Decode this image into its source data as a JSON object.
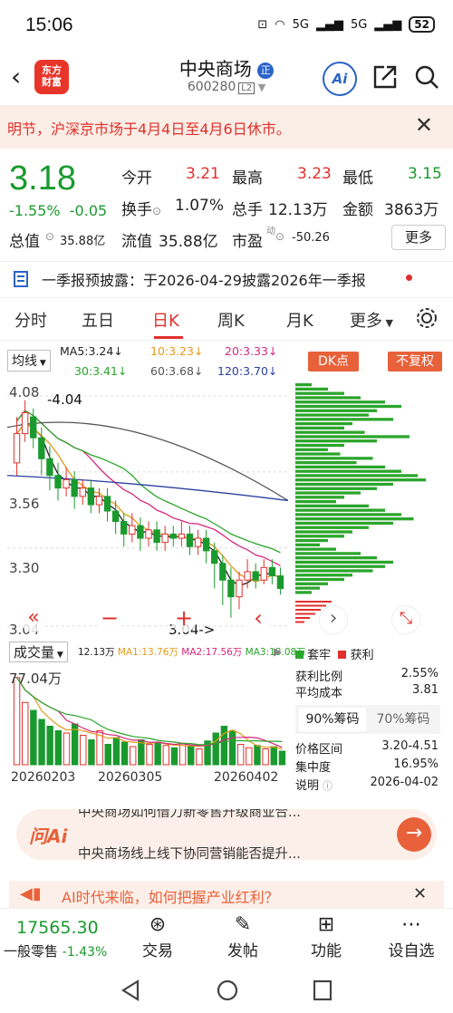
{
  "status_bar": {
    "time": "15:06",
    "battery": "52",
    "signal1": "5G",
    "signal2": "5G"
  },
  "header": {
    "logo_line1": "东方",
    "logo_line2": "财富",
    "stock_name": "中央商场",
    "name_badge": "正",
    "stock_code": "600280",
    "level_badge": "L2",
    "ai_label": "Ai"
  },
  "notice": {
    "text": "明节，沪深京市场于4月4日至4月6日休市。"
  },
  "quote": {
    "price": "3.18",
    "change_pct": "-1.55%",
    "change_amt": "-0.05",
    "open_label": "今开",
    "open": "3.21",
    "high_label": "最高",
    "high": "3.23",
    "low_label": "最低",
    "low": "3.15",
    "turnover_label": "换手",
    "turnover": "1.07%",
    "volume_label": "总手",
    "volume": "12.13万",
    "amount_label": "金额",
    "amount": "3863万",
    "mktcap_label": "总值",
    "mktcap": "35.88亿",
    "float_label": "流值",
    "float_cap": "35.88亿",
    "pe_label": "市盈",
    "pe_sup": "动",
    "pe": "-50.26",
    "more": "更多"
  },
  "report": {
    "text": "一季报预披露：于2026-04-29披露2026年一季报"
  },
  "tabs": [
    "分时",
    "五日",
    "日K",
    "周K",
    "月K",
    "更多"
  ],
  "active_tab": "日K",
  "ma": {
    "selector": "均线",
    "ma5": "MA5:3.24↓",
    "ma10": "10:3.23↓",
    "ma20": "20:3.33↓",
    "ma30": "30:3.41↓",
    "ma60": "60:3.68↓",
    "ma120": "120:3.70↓",
    "colors": {
      "ma5": "#222222",
      "ma10": "#e39a1c",
      "ma20": "#d4287e",
      "ma30": "#2ba52b",
      "ma60": "#555555",
      "ma120": "#2a3fa0"
    }
  },
  "dk": {
    "dk_label": "DK点",
    "fq_label": "不复权"
  },
  "chart_data": {
    "type": "candlestick",
    "y_labels": [
      "4.08",
      "3.56",
      "3.30",
      "3.04"
    ],
    "high_annotation": "4.04",
    "low_annotation": "3.04->",
    "ylim": [
      3.0,
      4.1
    ],
    "candles": [
      {
        "o": 3.78,
        "c": 3.92,
        "h": 4.0,
        "l": 3.72
      },
      {
        "o": 3.92,
        "c": 4.02,
        "h": 4.08,
        "l": 3.88
      },
      {
        "o": 4.0,
        "c": 3.9,
        "h": 4.04,
        "l": 3.85
      },
      {
        "o": 3.9,
        "c": 3.8,
        "h": 3.95,
        "l": 3.72
      },
      {
        "o": 3.8,
        "c": 3.72,
        "h": 3.86,
        "l": 3.65
      },
      {
        "o": 3.72,
        "c": 3.66,
        "h": 3.78,
        "l": 3.6
      },
      {
        "o": 3.66,
        "c": 3.7,
        "h": 3.76,
        "l": 3.62
      },
      {
        "o": 3.7,
        "c": 3.62,
        "h": 3.74,
        "l": 3.56
      },
      {
        "o": 3.62,
        "c": 3.66,
        "h": 3.7,
        "l": 3.58
      },
      {
        "o": 3.66,
        "c": 3.58,
        "h": 3.7,
        "l": 3.54
      },
      {
        "o": 3.58,
        "c": 3.62,
        "h": 3.66,
        "l": 3.54
      },
      {
        "o": 3.62,
        "c": 3.55,
        "h": 3.66,
        "l": 3.5
      },
      {
        "o": 3.55,
        "c": 3.5,
        "h": 3.6,
        "l": 3.44
      },
      {
        "o": 3.5,
        "c": 3.44,
        "h": 3.54,
        "l": 3.38
      },
      {
        "o": 3.44,
        "c": 3.48,
        "h": 3.54,
        "l": 3.4
      },
      {
        "o": 3.48,
        "c": 3.42,
        "h": 3.52,
        "l": 3.36
      },
      {
        "o": 3.42,
        "c": 3.46,
        "h": 3.5,
        "l": 3.38
      },
      {
        "o": 3.46,
        "c": 3.4,
        "h": 3.5,
        "l": 3.36
      },
      {
        "o": 3.4,
        "c": 3.44,
        "h": 3.48,
        "l": 3.36
      },
      {
        "o": 3.44,
        "c": 3.42,
        "h": 3.48,
        "l": 3.38
      },
      {
        "o": 3.42,
        "c": 3.44,
        "h": 3.5,
        "l": 3.38
      },
      {
        "o": 3.44,
        "c": 3.38,
        "h": 3.48,
        "l": 3.34
      },
      {
        "o": 3.38,
        "c": 3.42,
        "h": 3.46,
        "l": 3.34
      },
      {
        "o": 3.42,
        "c": 3.36,
        "h": 3.46,
        "l": 3.3
      },
      {
        "o": 3.36,
        "c": 3.3,
        "h": 3.4,
        "l": 3.18
      },
      {
        "o": 3.3,
        "c": 3.22,
        "h": 3.34,
        "l": 3.1
      },
      {
        "o": 3.22,
        "c": 3.14,
        "h": 3.28,
        "l": 3.04
      },
      {
        "o": 3.14,
        "c": 3.22,
        "h": 3.26,
        "l": 3.08
      },
      {
        "o": 3.22,
        "c": 3.26,
        "h": 3.32,
        "l": 3.18
      },
      {
        "o": 3.26,
        "c": 3.22,
        "h": 3.3,
        "l": 3.18
      },
      {
        "o": 3.22,
        "c": 3.28,
        "h": 3.32,
        "l": 3.2
      },
      {
        "o": 3.28,
        "c": 3.24,
        "h": 3.32,
        "l": 3.2
      },
      {
        "o": 3.24,
        "c": 3.18,
        "h": 3.28,
        "l": 3.15
      }
    ],
    "volume_label": "成交量",
    "volume_value": "12.13万",
    "vol_ma1": "MA1:13.76万",
    "vol_ma2": "MA2:17.56万",
    "vol_ma3": "MA3:18.08万",
    "vol_max_label": "77.04万",
    "volumes": [
      77,
      55,
      48,
      40,
      34,
      30,
      28,
      36,
      26,
      22,
      30,
      18,
      24,
      20,
      16,
      22,
      18,
      20,
      17,
      15,
      19,
      16,
      14,
      21,
      28,
      34,
      30,
      18,
      15,
      17,
      14,
      16,
      12
    ],
    "dates": [
      "20260203",
      "20260305",
      "20260402"
    ]
  },
  "controls": {
    "left": "«",
    "minus": "−",
    "plus": "+",
    "prev": "‹",
    "next": "›",
    "expand": "⤡"
  },
  "dk_panel": {
    "legend_trapped": "套牢",
    "legend_profit": "获利",
    "rows": [
      {
        "label": "获利比例",
        "value": "2.55%"
      },
      {
        "label": "平均成本",
        "value": "3.81"
      }
    ],
    "tab90": "90%筹码",
    "tab70": "70%筹码",
    "rows2": [
      {
        "label": "价格区间",
        "value": "3.20-4.51"
      },
      {
        "label": "集中度",
        "value": "16.95%"
      },
      {
        "label": "说明",
        "value": "2026-04-02"
      }
    ]
  },
  "ai_banner": {
    "logo": "问Ai",
    "line1": "中央商场如何借力新零售升级商业合...",
    "line2": "中央商场线上线下协同营销能否提升..."
  },
  "promo": {
    "text": "AI时代来临，如何把握产业红利？"
  },
  "bottom_nav": {
    "index_value": "17565.30",
    "index_name": "一般零售",
    "index_change": "-1.43%",
    "items": [
      "交易",
      "发帖",
      "功能",
      "设自选"
    ]
  }
}
